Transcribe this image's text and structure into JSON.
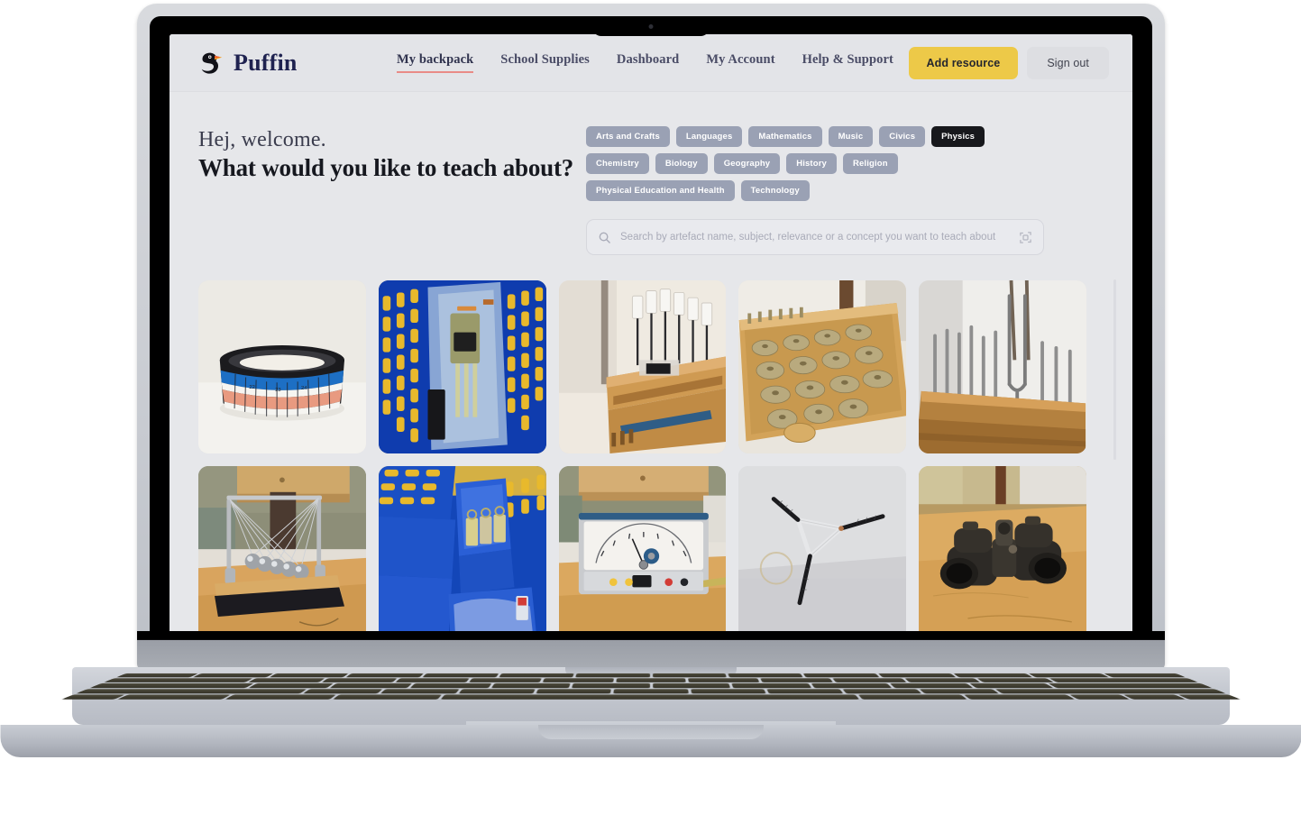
{
  "brand": {
    "name": "Puffin",
    "logo_icon": "puffin-icon"
  },
  "nav": {
    "items": [
      {
        "label": "My backpack",
        "active": true
      },
      {
        "label": "School Supplies",
        "active": false
      },
      {
        "label": "Dashboard",
        "active": false
      },
      {
        "label": "My Account",
        "active": false
      },
      {
        "label": "Help & Support",
        "active": false
      }
    ]
  },
  "actions": {
    "add_resource": "Add resource",
    "sign_out": "Sign out",
    "primary_color": "#edc948"
  },
  "hero": {
    "greeting": "Hej, welcome.",
    "headline": "What would you like to teach about?"
  },
  "subjects": [
    {
      "label": "Arts and Crafts",
      "selected": false
    },
    {
      "label": "Languages",
      "selected": false
    },
    {
      "label": "Mathematics",
      "selected": false
    },
    {
      "label": "Music",
      "selected": false
    },
    {
      "label": "Civics",
      "selected": false
    },
    {
      "label": "Physics",
      "selected": true
    },
    {
      "label": "Chemistry",
      "selected": false
    },
    {
      "label": "Biology",
      "selected": false
    },
    {
      "label": "Geography",
      "selected": false
    },
    {
      "label": "History",
      "selected": false
    },
    {
      "label": "Religion",
      "selected": false
    },
    {
      "label": "Physical Education and Health",
      "selected": false
    },
    {
      "label": "Technology",
      "selected": false
    }
  ],
  "search": {
    "placeholder": "Search by artefact name, subject, relevance or a concept you want to teach about",
    "value": "",
    "leading_icon": "search-icon",
    "trailing_icon": "scan-icon"
  },
  "results": {
    "items": [
      {
        "name": "measuring-bowl-artefact",
        "alt": "Black bowl with blue and red measuring scale band"
      },
      {
        "name": "blue-basket-instruments-artefact",
        "alt": "Blue slotted basket holding packaged lab instruments"
      },
      {
        "name": "wooden-stand-probes-artefact",
        "alt": "Wooden crate with white paddle probes and labels"
      },
      {
        "name": "brass-weights-tray-artefact",
        "alt": "Wooden tray of brass cylindrical weights"
      },
      {
        "name": "tuning-forks-rack-artefact",
        "alt": "Wooden rack of metal tuning forks"
      },
      {
        "name": "newtons-cradle-artefact",
        "alt": "Newton's cradle on a wooden table"
      },
      {
        "name": "blue-box-brass-weights-artefact",
        "alt": "Blue storage box containing brass weights"
      },
      {
        "name": "analog-galvanometer-artefact",
        "alt": "Analog meter instrument on a wooden table"
      },
      {
        "name": "triangle-magnet-assembly-artefact",
        "alt": "Three black magnet rods joined in a triangle on white board"
      },
      {
        "name": "binoculars-artefact",
        "alt": "Black binoculars on a wooden table"
      }
    ]
  },
  "scrollbar": {
    "name": "results-scrollbar"
  },
  "device": {
    "type": "laptop-mockup"
  }
}
